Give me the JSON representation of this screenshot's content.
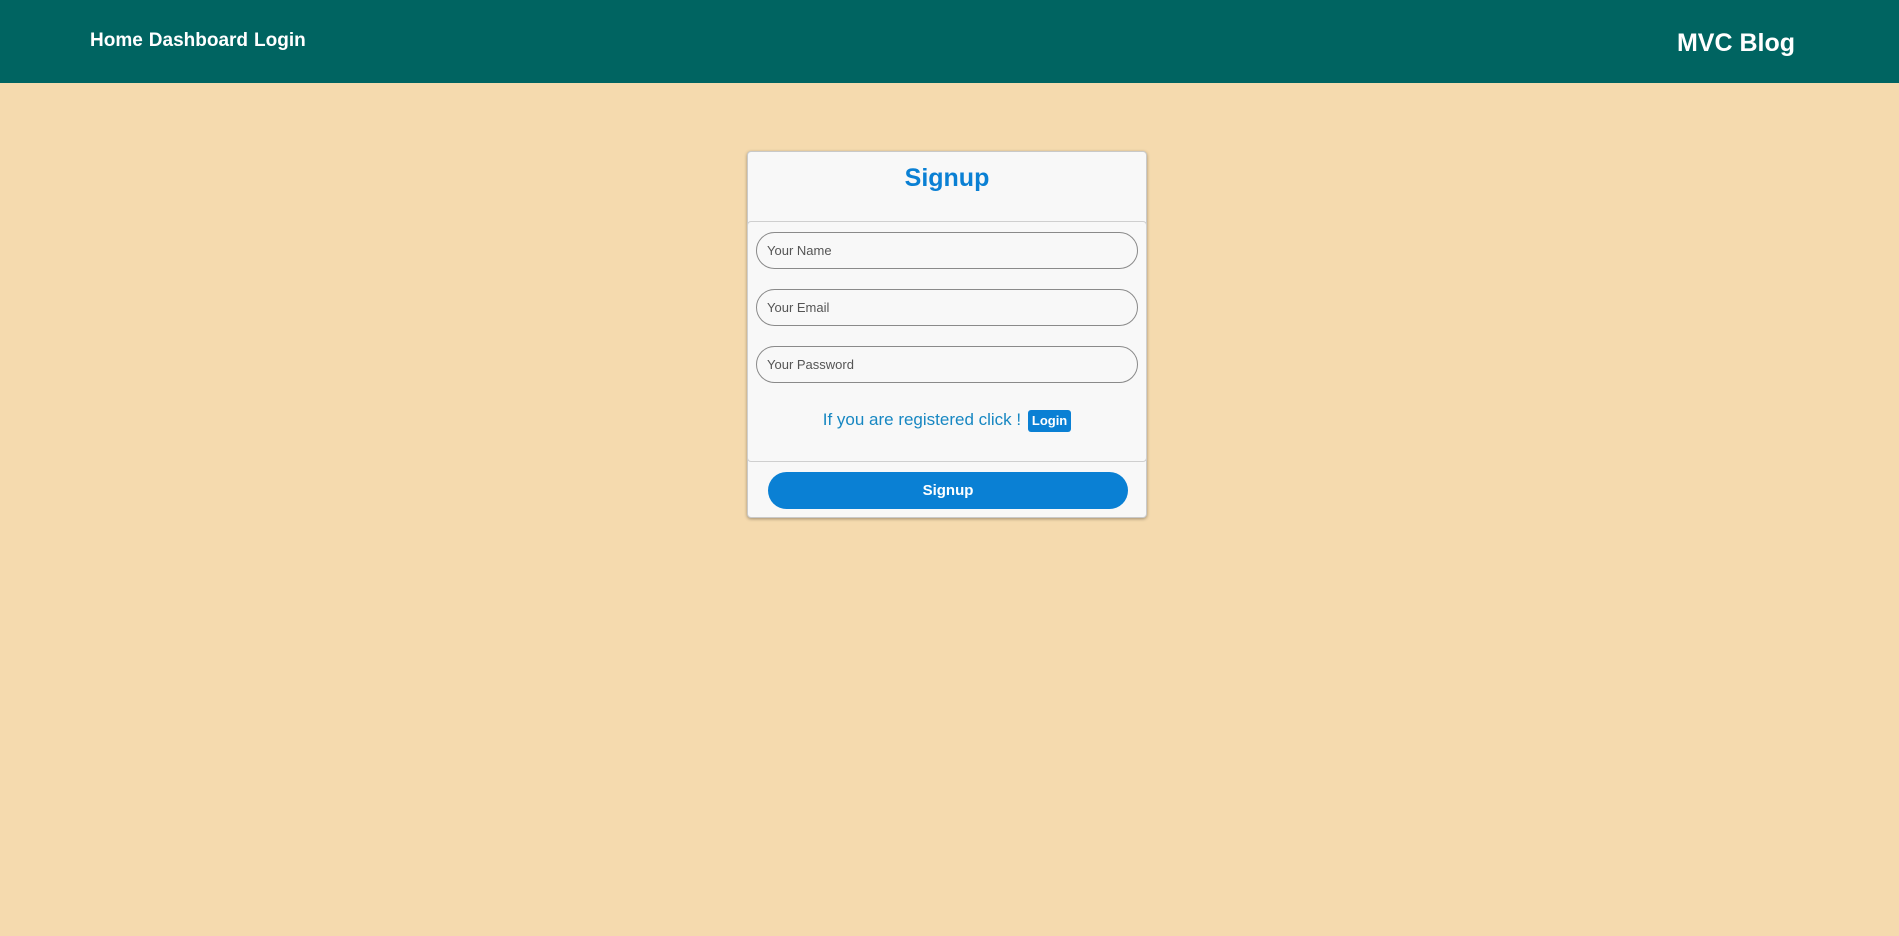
{
  "nav": {
    "items": [
      "Home",
      "Dashboard",
      "Login"
    ]
  },
  "brand": "MVC Blog",
  "card": {
    "title": "Signup",
    "fields": {
      "name": {
        "value": "",
        "placeholder": "Your Name"
      },
      "email": {
        "value": "",
        "placeholder": "Your Email"
      },
      "password": {
        "value": "",
        "placeholder": "Your Password"
      }
    },
    "registered_text": "If you are registered click !",
    "login_label": "Login",
    "submit_label": "Signup"
  },
  "colors": {
    "background": "#f5daae",
    "topbar": "#006461",
    "accent": "#0a80d4",
    "link_text": "#1787c2"
  }
}
